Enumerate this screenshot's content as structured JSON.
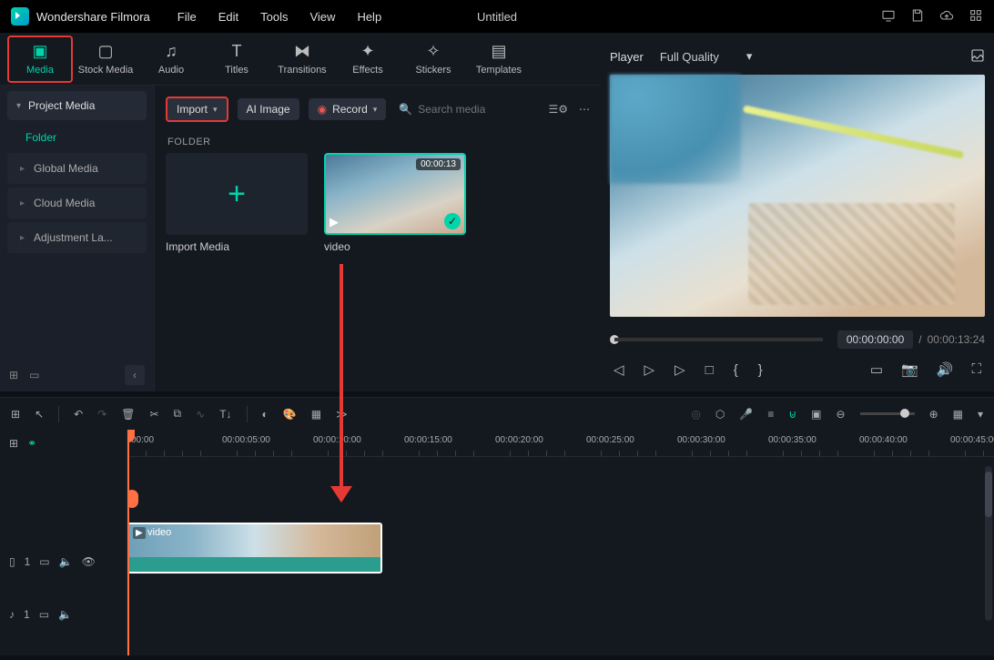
{
  "app": {
    "name": "Wondershare Filmora",
    "title": "Untitled"
  },
  "menu": {
    "file": "File",
    "edit": "Edit",
    "tools": "Tools",
    "view": "View",
    "help": "Help"
  },
  "tabs": {
    "media": "Media",
    "stock": "Stock Media",
    "audio": "Audio",
    "titles": "Titles",
    "transitions": "Transitions",
    "effects": "Effects",
    "stickers": "Stickers",
    "templates": "Templates"
  },
  "sidebar": {
    "project_media": "Project Media",
    "folder": "Folder",
    "global_media": "Global Media",
    "cloud_media": "Cloud Media",
    "adjustment": "Adjustment La..."
  },
  "toolbar": {
    "import": "Import",
    "ai_image": "AI Image",
    "record": "Record",
    "search_placeholder": "Search media"
  },
  "content": {
    "folder_header": "FOLDER",
    "import_media": "Import Media",
    "video_label": "video",
    "video_duration": "00:00:13"
  },
  "player": {
    "label": "Player",
    "quality": "Full Quality",
    "current": "00:00:00:00",
    "total": "00:00:13:24",
    "sep": "/"
  },
  "ruler": [
    "00:00",
    "00:00:05:00",
    "00:00:10:00",
    "00:00:15:00",
    "00:00:20:00",
    "00:00:25:00",
    "00:00:30:00",
    "00:00:35:00",
    "00:00:40:00",
    "00:00:45:00"
  ],
  "timeline": {
    "clip_label": "video",
    "video_track_num": "1",
    "audio_track_num": "1"
  }
}
